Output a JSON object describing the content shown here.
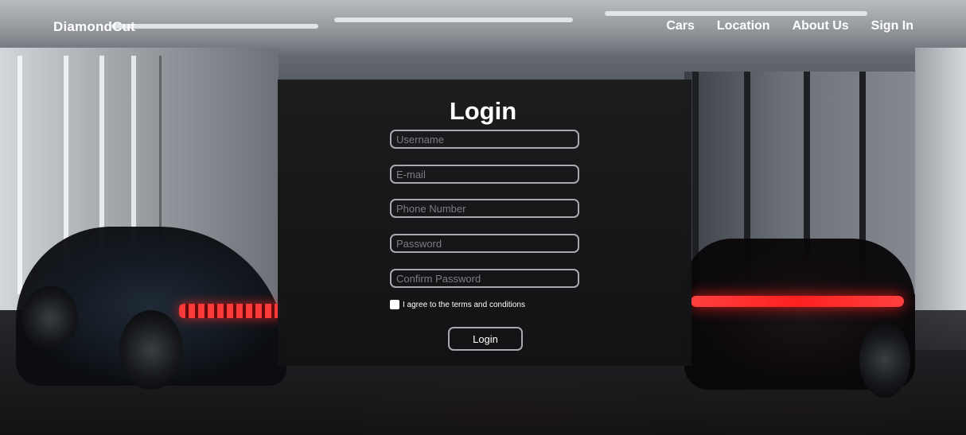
{
  "header": {
    "brand": "DiamondCut",
    "nav": [
      "Cars",
      "Location",
      "About Us",
      "Sign In"
    ]
  },
  "login": {
    "title": "Login",
    "fields": {
      "username": {
        "placeholder": "Username",
        "value": ""
      },
      "email": {
        "placeholder": "E-mail",
        "value": ""
      },
      "phone": {
        "placeholder": "Phone Number",
        "value": ""
      },
      "password": {
        "placeholder": "Password",
        "value": ""
      },
      "confirm_password": {
        "placeholder": "Confirm Password",
        "value": ""
      }
    },
    "terms_label": "I agree to the terms and conditions",
    "terms_checked": false,
    "submit_label": "Login"
  },
  "colors": {
    "text": "#ffffff",
    "field_border": "#a9a9ad",
    "card_bg": "#1a1a1c",
    "accent_red": "#ff3030"
  }
}
